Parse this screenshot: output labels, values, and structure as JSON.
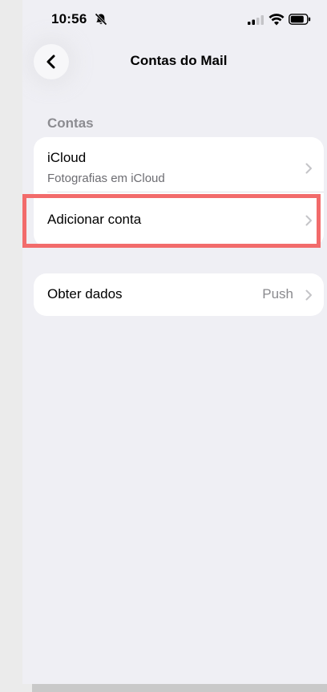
{
  "status_bar": {
    "time": "10:56",
    "icons": [
      "bell-slash-icon",
      "cellular-signal-icon",
      "wifi-icon",
      "battery-icon"
    ]
  },
  "nav": {
    "back_icon": "chevron-left-icon",
    "title": "Contas do Mail"
  },
  "accounts_section": {
    "header": "Contas",
    "rows": [
      {
        "title": "iCloud",
        "subtitle": "Fotografias em iCloud"
      },
      {
        "title": "Adicionar conta",
        "highlighted": true
      }
    ]
  },
  "fetch_section": {
    "row": {
      "title": "Obter dados",
      "value": "Push"
    }
  },
  "colors": {
    "background": "#efeff4",
    "card": "#ffffff",
    "highlight": "#f26b6b",
    "secondary_text": "#8a8a8e"
  }
}
